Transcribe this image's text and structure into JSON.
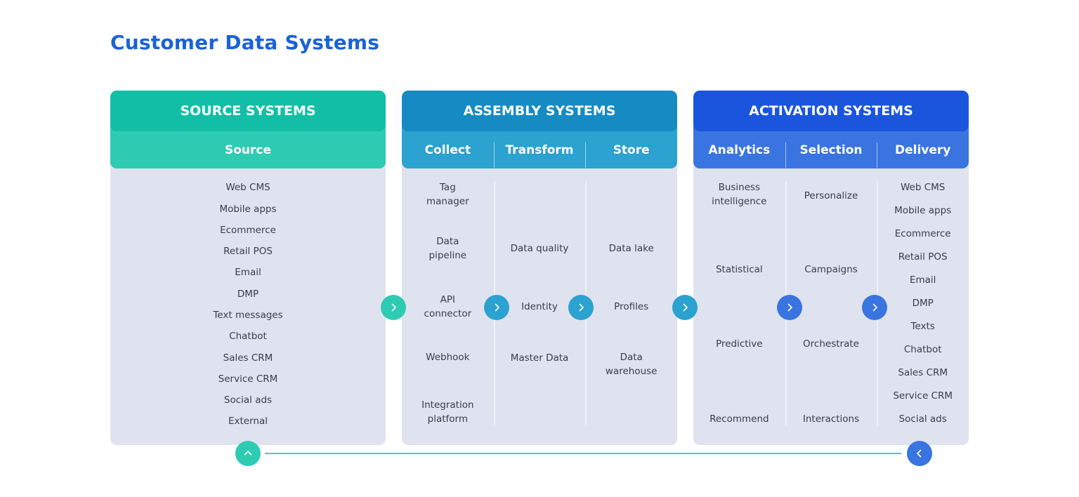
{
  "title": "Customer Data Systems",
  "colors": {
    "title": "#1a63d6",
    "source_dark": "#12bfa6",
    "source_light": "#2ecbb3",
    "assembly_dark": "#168bc3",
    "assembly_light": "#2ba2cf",
    "activation_dark": "#1b55de",
    "activation_light": "#3a74e0",
    "panel_bg": "#dfe3ef",
    "connector_line": "#3fd1b7"
  },
  "panels": [
    {
      "title": "SOURCE SYSTEMS",
      "columns": [
        {
          "label": "Source",
          "items": [
            "Web CMS",
            "Mobile apps",
            "Ecommerce",
            "Retail POS",
            "Email",
            "DMP",
            "Text messages",
            "Chatbot",
            "Sales CRM",
            "Service CRM",
            "Social ads",
            "External"
          ]
        }
      ]
    },
    {
      "title": "ASSEMBLY SYSTEMS",
      "columns": [
        {
          "label": "Collect",
          "items": [
            "Tag\nmanager",
            "Data\npipeline",
            "API\nconnector",
            "Webhook",
            "Integration\nplatform"
          ]
        },
        {
          "label": "Transform",
          "items": [
            "Data quality",
            "Identity",
            "Master Data"
          ]
        },
        {
          "label": "Store",
          "items": [
            "Data lake",
            "Profiles",
            "Data\nwarehouse"
          ]
        }
      ]
    },
    {
      "title": "ACTIVATION SYSTEMS",
      "columns": [
        {
          "label": "Analytics",
          "items": [
            "Business\nintelligence",
            "Statistical",
            "Predictive",
            "Recommend"
          ]
        },
        {
          "label": "Selection",
          "items": [
            "Personalize",
            "Campaigns",
            "Orchestrate",
            "Interactions"
          ]
        },
        {
          "label": "Delivery",
          "items": [
            "Web CMS",
            "Mobile apps",
            "Ecommerce",
            "Retail POS",
            "Email",
            "DMP",
            "Texts",
            "Chatbot",
            "Sales CRM",
            "Service CRM",
            "Social ads"
          ]
        }
      ]
    }
  ],
  "arrows": [
    {
      "name": "source-to-assembly",
      "icon": "chevron-right-icon"
    },
    {
      "name": "collect-to-transform",
      "icon": "chevron-right-icon"
    },
    {
      "name": "transform-to-store",
      "icon": "chevron-right-icon"
    },
    {
      "name": "assembly-to-activation",
      "icon": "chevron-right-icon"
    },
    {
      "name": "analytics-to-selection",
      "icon": "chevron-right-icon"
    },
    {
      "name": "selection-to-delivery",
      "icon": "chevron-right-icon"
    },
    {
      "name": "feedback-start",
      "icon": "chevron-up-icon"
    },
    {
      "name": "feedback-end",
      "icon": "chevron-left-icon"
    }
  ]
}
